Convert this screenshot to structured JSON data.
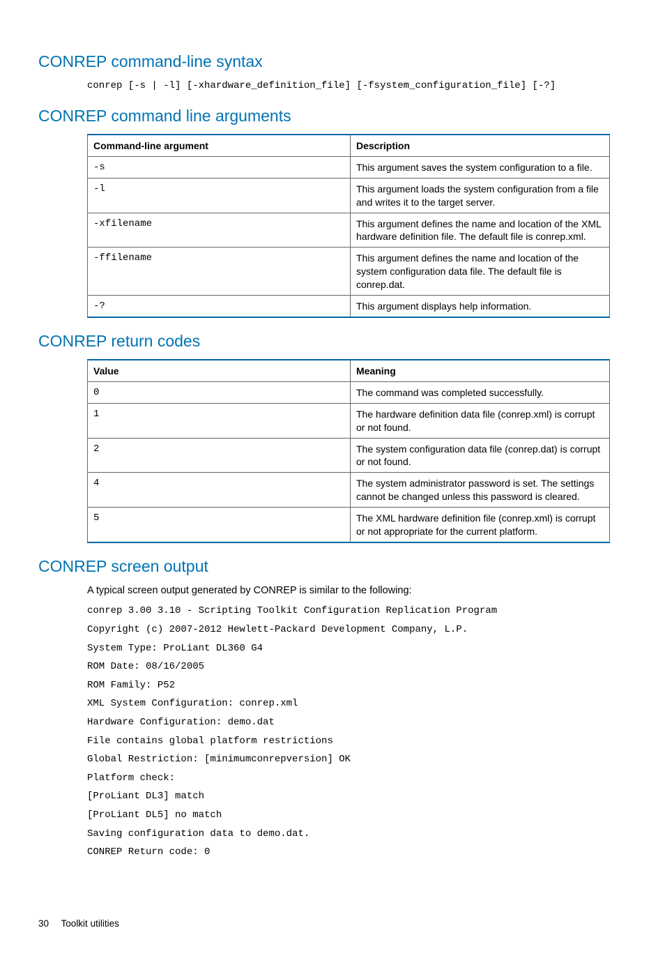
{
  "sections": {
    "syntax": {
      "heading": "CONREP command-line syntax",
      "code": "conrep [-s | -l] [-xhardware_definition_file] [-fsystem_configuration_file] [-?]"
    },
    "args": {
      "heading": "CONREP command line arguments",
      "col1": "Command-line argument",
      "col2": "Description",
      "rows": [
        {
          "arg": "-s",
          "desc": "This argument saves the system configuration to a file."
        },
        {
          "arg": "-l",
          "desc": "This argument loads the system configuration from a file and writes it to the target server."
        },
        {
          "arg": "-xfilename",
          "desc": "This argument defines the name and location of the XML hardware definition file. The default file is conrep.xml."
        },
        {
          "arg": "-ffilename",
          "desc": "This argument defines the name and location of the system configuration data file. The default file is conrep.dat."
        },
        {
          "arg": "-?",
          "desc": "This argument displays help information."
        }
      ]
    },
    "codes": {
      "heading": "CONREP return codes",
      "col1": "Value",
      "col2": "Meaning",
      "rows": [
        {
          "val": "0",
          "desc": "The command was completed successfully."
        },
        {
          "val": "1",
          "desc": "The hardware definition data file (conrep.xml) is corrupt or not found."
        },
        {
          "val": "2",
          "desc": "The system configuration data file (conrep.dat) is corrupt or not found."
        },
        {
          "val": "4",
          "desc": "The system administrator password is set. The settings cannot be changed unless this password is cleared."
        },
        {
          "val": "5",
          "desc": "The XML hardware definition file (conrep.xml) is corrupt or not appropriate for the current platform."
        }
      ]
    },
    "output": {
      "heading": "CONREP screen output",
      "intro": "A typical screen output generated by CONREP is similar to the following:",
      "lines": "conrep 3.00 3.10 - Scripting Toolkit Configuration Replication Program\nCopyright (c) 2007-2012 Hewlett-Packard Development Company, L.P.\nSystem Type: ProLiant DL360 G4\nROM Date: 08/16/2005\nROM Family: P52\nXML System Configuration: conrep.xml\nHardware Configuration: demo.dat\nFile contains global platform restrictions\nGlobal Restriction: [minimumconrepversion] OK\nPlatform check:\n[ProLiant DL3] match\n[ProLiant DL5] no match\nSaving configuration data to demo.dat.\nCONREP Return code: 0"
    }
  },
  "footer": {
    "page": "30",
    "title": "Toolkit utilities"
  }
}
